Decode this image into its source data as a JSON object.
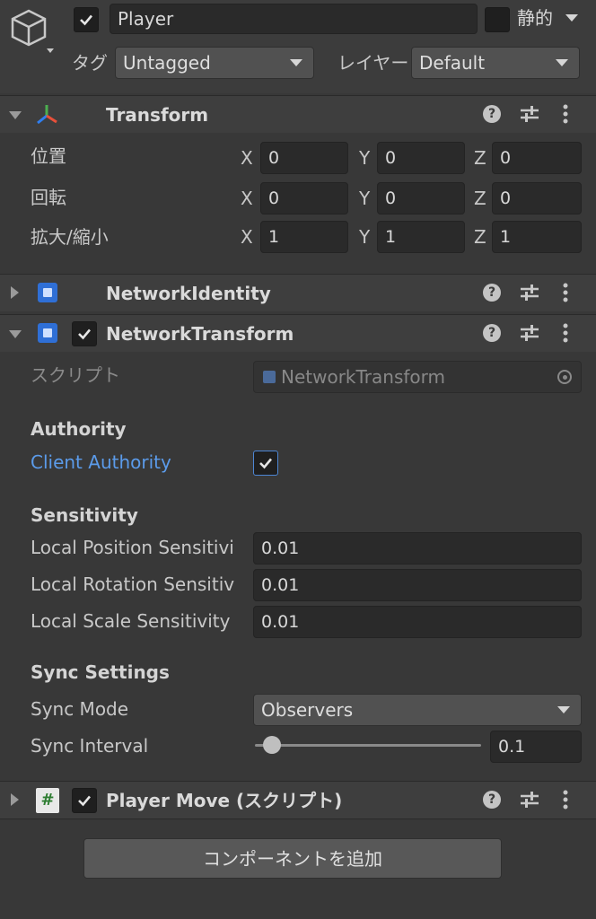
{
  "header": {
    "object_name": "Player",
    "active": true,
    "static_label": "静的",
    "static_checked": false,
    "tag_label": "タグ",
    "tag_value": "Untagged",
    "layer_label": "レイヤー",
    "layer_value": "Default"
  },
  "transform": {
    "title": "Transform",
    "rows": [
      {
        "label": "位置",
        "x": "0",
        "y": "0",
        "z": "0"
      },
      {
        "label": "回転",
        "x": "0",
        "y": "0",
        "z": "0"
      },
      {
        "label": "拡大/縮小",
        "x": "1",
        "y": "1",
        "z": "1"
      }
    ],
    "axes": [
      "X",
      "Y",
      "Z"
    ]
  },
  "network_identity": {
    "title": "NetworkIdentity"
  },
  "network_transform": {
    "title": "NetworkTransform",
    "enabled": true,
    "script_label": "スクリプト",
    "script_value": "NetworkTransform",
    "authority_title": "Authority",
    "client_authority_label": "Client Authority",
    "client_authority_checked": true,
    "sensitivity_title": "Sensitivity",
    "local_position_label": "Local Position Sensitivi",
    "local_position_value": "0.01",
    "local_rotation_label": "Local Rotation Sensitiv",
    "local_rotation_value": "0.01",
    "local_scale_label": "Local Scale Sensitivity",
    "local_scale_value": "0.01",
    "sync_settings_title": "Sync Settings",
    "sync_mode_label": "Sync Mode",
    "sync_mode_value": "Observers",
    "sync_interval_label": "Sync Interval",
    "sync_interval_value": "0.1"
  },
  "player_move": {
    "title": "Player Move (スクリプト)",
    "enabled": true,
    "icon_glyph": "#"
  },
  "add_component_label": "コンポーネントを追加",
  "colors": {
    "accent_blue": "#5b9bea",
    "panel": "#383838",
    "bar": "#3e3e3e"
  }
}
